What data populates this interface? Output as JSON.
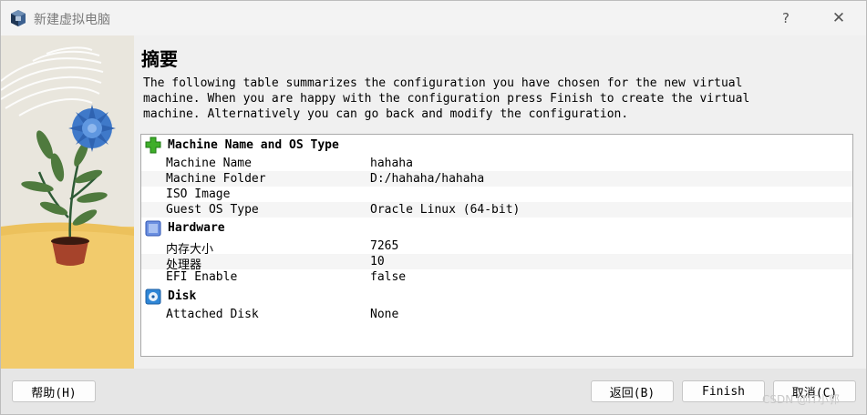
{
  "window": {
    "title": "新建虚拟电脑",
    "help_glyph": "?",
    "close_glyph": "✕",
    "app_icon": "virtualbox-cube-icon"
  },
  "page": {
    "title": "摘要",
    "description": "The following table summarizes the configuration you have chosen for the new virtual\nmachine. When you are happy with the configuration press Finish to create the virtual\nmachine. Alternatively you can go back and modify the configuration."
  },
  "summary": {
    "sections": [
      {
        "label": "Machine Name and OS Type",
        "icon": "green-puzzle-icon",
        "rows": [
          {
            "key": "Machine Name",
            "value": "hahaha"
          },
          {
            "key": "Machine Folder",
            "value": "D:/hahaha/hahaha"
          },
          {
            "key": "ISO Image",
            "value": ""
          },
          {
            "key": "Guest OS Type",
            "value": "Oracle Linux (64-bit)"
          }
        ]
      },
      {
        "label": "Hardware",
        "icon": "chip-icon",
        "rows": [
          {
            "key": "内存大小",
            "value": "7265"
          },
          {
            "key": "处理器",
            "value": "10"
          },
          {
            "key": "EFI Enable",
            "value": "false"
          }
        ]
      },
      {
        "label": "Disk",
        "icon": "hard-disk-icon",
        "rows": [
          {
            "key": "Attached Disk",
            "value": "None"
          }
        ]
      }
    ]
  },
  "footer": {
    "help_label": "帮助(H)",
    "back_label": "返回(B)",
    "finish_label": "Finish",
    "cancel_label": "取消(C)"
  },
  "watermark": "CSDN @IT小郭"
}
